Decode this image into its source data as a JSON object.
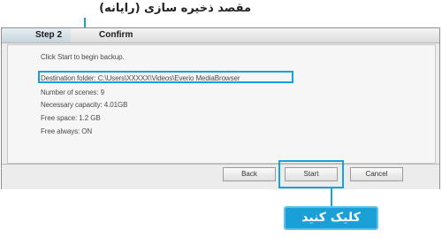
{
  "annotations": {
    "destination_caption": "مقصد ذخیره سازی (رایانه)",
    "click_caption": "کلیک کنید"
  },
  "wizard": {
    "steps": [
      {
        "label": "Step 2"
      },
      {
        "label": "Confirm"
      }
    ],
    "lines": [
      "Click Start to begin backup.",
      "Destination folder: C:\\Users\\XXXXX\\Videos\\Everio MediaBrowser",
      "Number of scenes: 9",
      "Necessary capacity: 4.01GB",
      "Free space: 1.2 GB",
      "Free always: ON"
    ],
    "buttons": {
      "back": "Back",
      "start": "Start",
      "cancel": "Cancel"
    }
  },
  "colors": {
    "annotation": "#1a9fd6",
    "window_bg": "#ececec"
  }
}
